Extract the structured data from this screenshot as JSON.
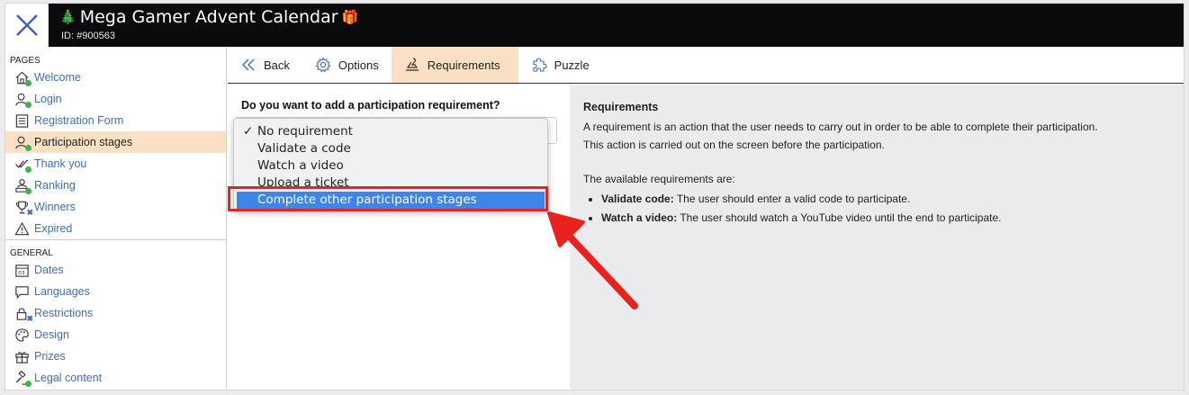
{
  "header": {
    "title": "Mega Gamer Advent Calendar",
    "id_label": "ID: #900563",
    "title_emoji_left": "🎄",
    "title_emoji_right": "🎁",
    "background": "#0b0b0d"
  },
  "sidebar": {
    "section_pages": "PAGES",
    "pages": [
      {
        "label": "Welcome",
        "icon": "home-icon",
        "status": "ok"
      },
      {
        "label": "Login",
        "icon": "user-icon",
        "status": "ok"
      },
      {
        "label": "Registration Form",
        "icon": "form-icon",
        "status": "none"
      },
      {
        "label": "Participation stages",
        "icon": "user-stages-icon",
        "status": "ok",
        "active": true
      },
      {
        "label": "Thank you",
        "icon": "check-double-icon",
        "status": "ok"
      },
      {
        "label": "Ranking",
        "icon": "podium-user-icon",
        "status": "ok"
      },
      {
        "label": "Winners",
        "icon": "trophy-icon",
        "status": "x"
      },
      {
        "label": "Expired",
        "icon": "warning-icon",
        "status": "none"
      }
    ],
    "section_general": "GENERAL",
    "general": [
      {
        "label": "Dates",
        "icon": "calendar-icon",
        "status": "none"
      },
      {
        "label": "Languages",
        "icon": "speech-bubble-icon",
        "status": "none"
      },
      {
        "label": "Restrictions",
        "icon": "lock-icon",
        "status": "x"
      },
      {
        "label": "Design",
        "icon": "palette-icon",
        "status": "none"
      },
      {
        "label": "Prizes",
        "icon": "gift-icon",
        "status": "none"
      },
      {
        "label": "Legal content",
        "icon": "gavel-icon",
        "status": "ok"
      }
    ]
  },
  "tabs": [
    {
      "label": "Back",
      "icon": "double-chevron-left-icon"
    },
    {
      "label": "Options",
      "icon": "gear-icon"
    },
    {
      "label": "Requirements",
      "icon": "stamp-icon",
      "active": true
    },
    {
      "label": "Puzzle",
      "icon": "puzzle-icon"
    }
  ],
  "form": {
    "question": "Do you want to add a participation requirement?",
    "options": [
      {
        "label": "No requirement",
        "checked": true
      },
      {
        "label": "Validate a code"
      },
      {
        "label": "Watch a video"
      },
      {
        "label": "Upload a ticket"
      },
      {
        "label": "Complete other participation stages",
        "highlighted": true
      }
    ],
    "check_glyph": "✓"
  },
  "help": {
    "title": "Requirements",
    "line1": "A requirement is an action that the user needs to carry out in order to be able to complete their participation.",
    "line2": "This action is carried out on the screen before the participation.",
    "line3": "The available requirements are:",
    "bullets": [
      {
        "term": "Validate code:",
        "text": " The user should enter a valid code to participate."
      },
      {
        "term": "Watch a video:",
        "text": " The user should watch a YouTube video until the end to participate."
      }
    ]
  },
  "colors": {
    "accent_link": "#3d6fbf",
    "active_bg": "#fbe0c3",
    "ok_dot": "#39b54a",
    "highlight": "#3b86e8",
    "annotation_red": "#e8221c"
  }
}
